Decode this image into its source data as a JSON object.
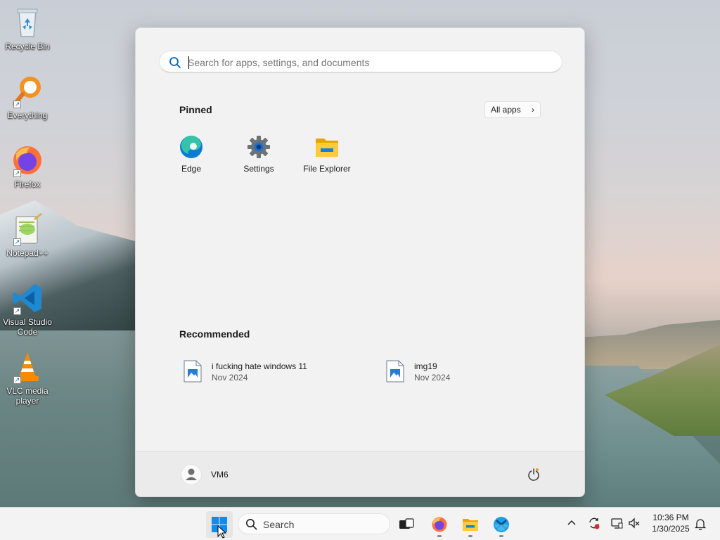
{
  "desktop": {
    "icons": [
      {
        "label": "Recycle Bin",
        "icon": "recycle-bin-icon"
      },
      {
        "label": "Everything",
        "icon": "everything-search-icon"
      },
      {
        "label": "Firefox",
        "icon": "firefox-icon"
      },
      {
        "label": "Notepad++",
        "icon": "notepad-plus-plus-icon"
      },
      {
        "label": "Visual Studio Code",
        "icon": "vscode-icon"
      },
      {
        "label": "VLC media player",
        "icon": "vlc-icon"
      }
    ]
  },
  "start_menu": {
    "search_placeholder": "Search for apps, settings, and documents",
    "pinned_title": "Pinned",
    "all_apps_label": "All apps",
    "pinned": [
      {
        "label": "Edge",
        "icon": "edge-icon"
      },
      {
        "label": "Settings",
        "icon": "settings-gear-icon"
      },
      {
        "label": "File Explorer",
        "icon": "file-explorer-icon"
      }
    ],
    "recommended_title": "Recommended",
    "recommended": [
      {
        "name": "i fucking hate windows 11",
        "date": "Nov 2024",
        "icon": "image-file-icon"
      },
      {
        "name": "img19",
        "date": "Nov 2024",
        "icon": "image-file-icon"
      }
    ],
    "user_name": "VM6"
  },
  "taskbar": {
    "search_label": "Search",
    "apps": [
      "start-windows-icon",
      "task-view-icon",
      "firefox-icon",
      "file-explorer-icon",
      "snipping-tool-icon"
    ],
    "time": "10:36 PM",
    "date": "1/30/2025"
  },
  "colors": {
    "accent": "#0067c0",
    "menu_bg": "#f2f2f2",
    "taskbar_bg": "#f3f3f3"
  }
}
